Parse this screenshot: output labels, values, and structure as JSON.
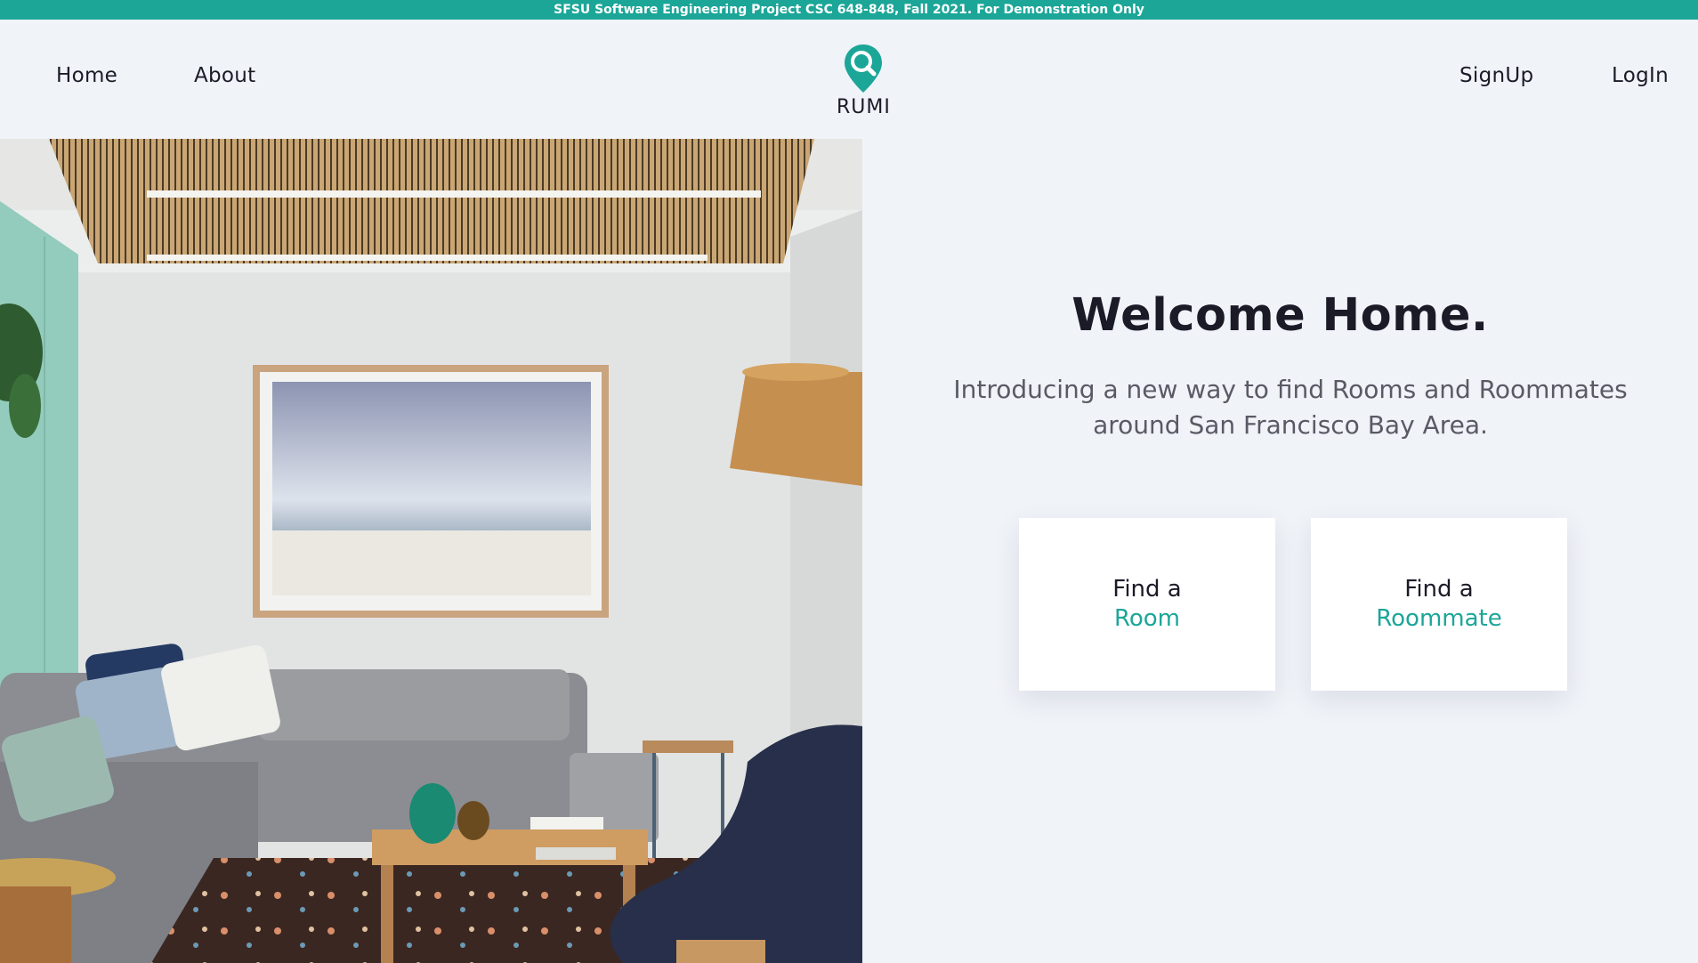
{
  "banner": {
    "text": "SFSU Software Engineering Project CSC 648-848, Fall 2021. For Demonstration Only"
  },
  "nav": {
    "home": "Home",
    "about": "About",
    "signup": "SignUp",
    "login": "LogIn",
    "logo_text": "RUMI",
    "logo_icon": "map-pin-search-icon"
  },
  "hero": {
    "image": "living-room-photo",
    "title": "Welcome Home.",
    "intro": "Introducing a new way to find Rooms and Roommates around San Francisco Bay Area."
  },
  "cards": [
    {
      "line1": "Find a",
      "line2": "Room"
    },
    {
      "line1": "Find a",
      "line2": "Roommate"
    }
  ],
  "colors": {
    "accent": "#1ba698",
    "background": "#f0f3f8",
    "text": "#1b1b28",
    "muted_text": "#5a5a66"
  }
}
